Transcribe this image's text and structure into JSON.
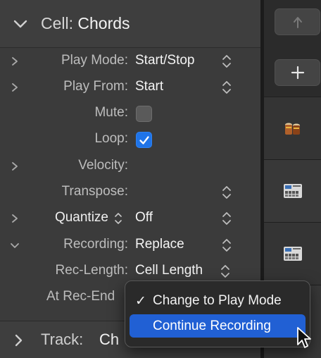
{
  "inspector": {
    "header": {
      "label": "Cell:",
      "value": "Chords"
    },
    "rows": [
      {
        "label": "Play Mode:",
        "value": "Start/Stop"
      },
      {
        "label": "Play From:",
        "value": "Start"
      },
      {
        "label": "Mute:",
        "checked": false
      },
      {
        "label": "Loop:",
        "checked": true
      },
      {
        "label": "Velocity:"
      },
      {
        "label": "Transpose:"
      },
      {
        "label": "Quantize",
        "value": "Off"
      },
      {
        "label": "Recording:",
        "value": "Replace"
      },
      {
        "label": "Rec-Length:",
        "value": "Cell Length"
      },
      {
        "label": "At Rec-End"
      }
    ],
    "footer": {
      "label": "Track:",
      "value": "Ch"
    }
  },
  "popup_menu": {
    "items": [
      {
        "label": "Change to Play Mode",
        "checked": true,
        "highlighted": false
      },
      {
        "label": "Continue Recording",
        "checked": false,
        "highlighted": true
      }
    ]
  },
  "right_column": {
    "buttons": [
      "back-arrow-icon",
      "plus-icon"
    ],
    "tracks": [
      "drum-kit-icon",
      "drum-machine-icon",
      "drum-machine-icon"
    ]
  },
  "colors": {
    "accent": "#1f74e8",
    "menu_highlight": "#2160d4",
    "panel": "#3b3b3b"
  }
}
